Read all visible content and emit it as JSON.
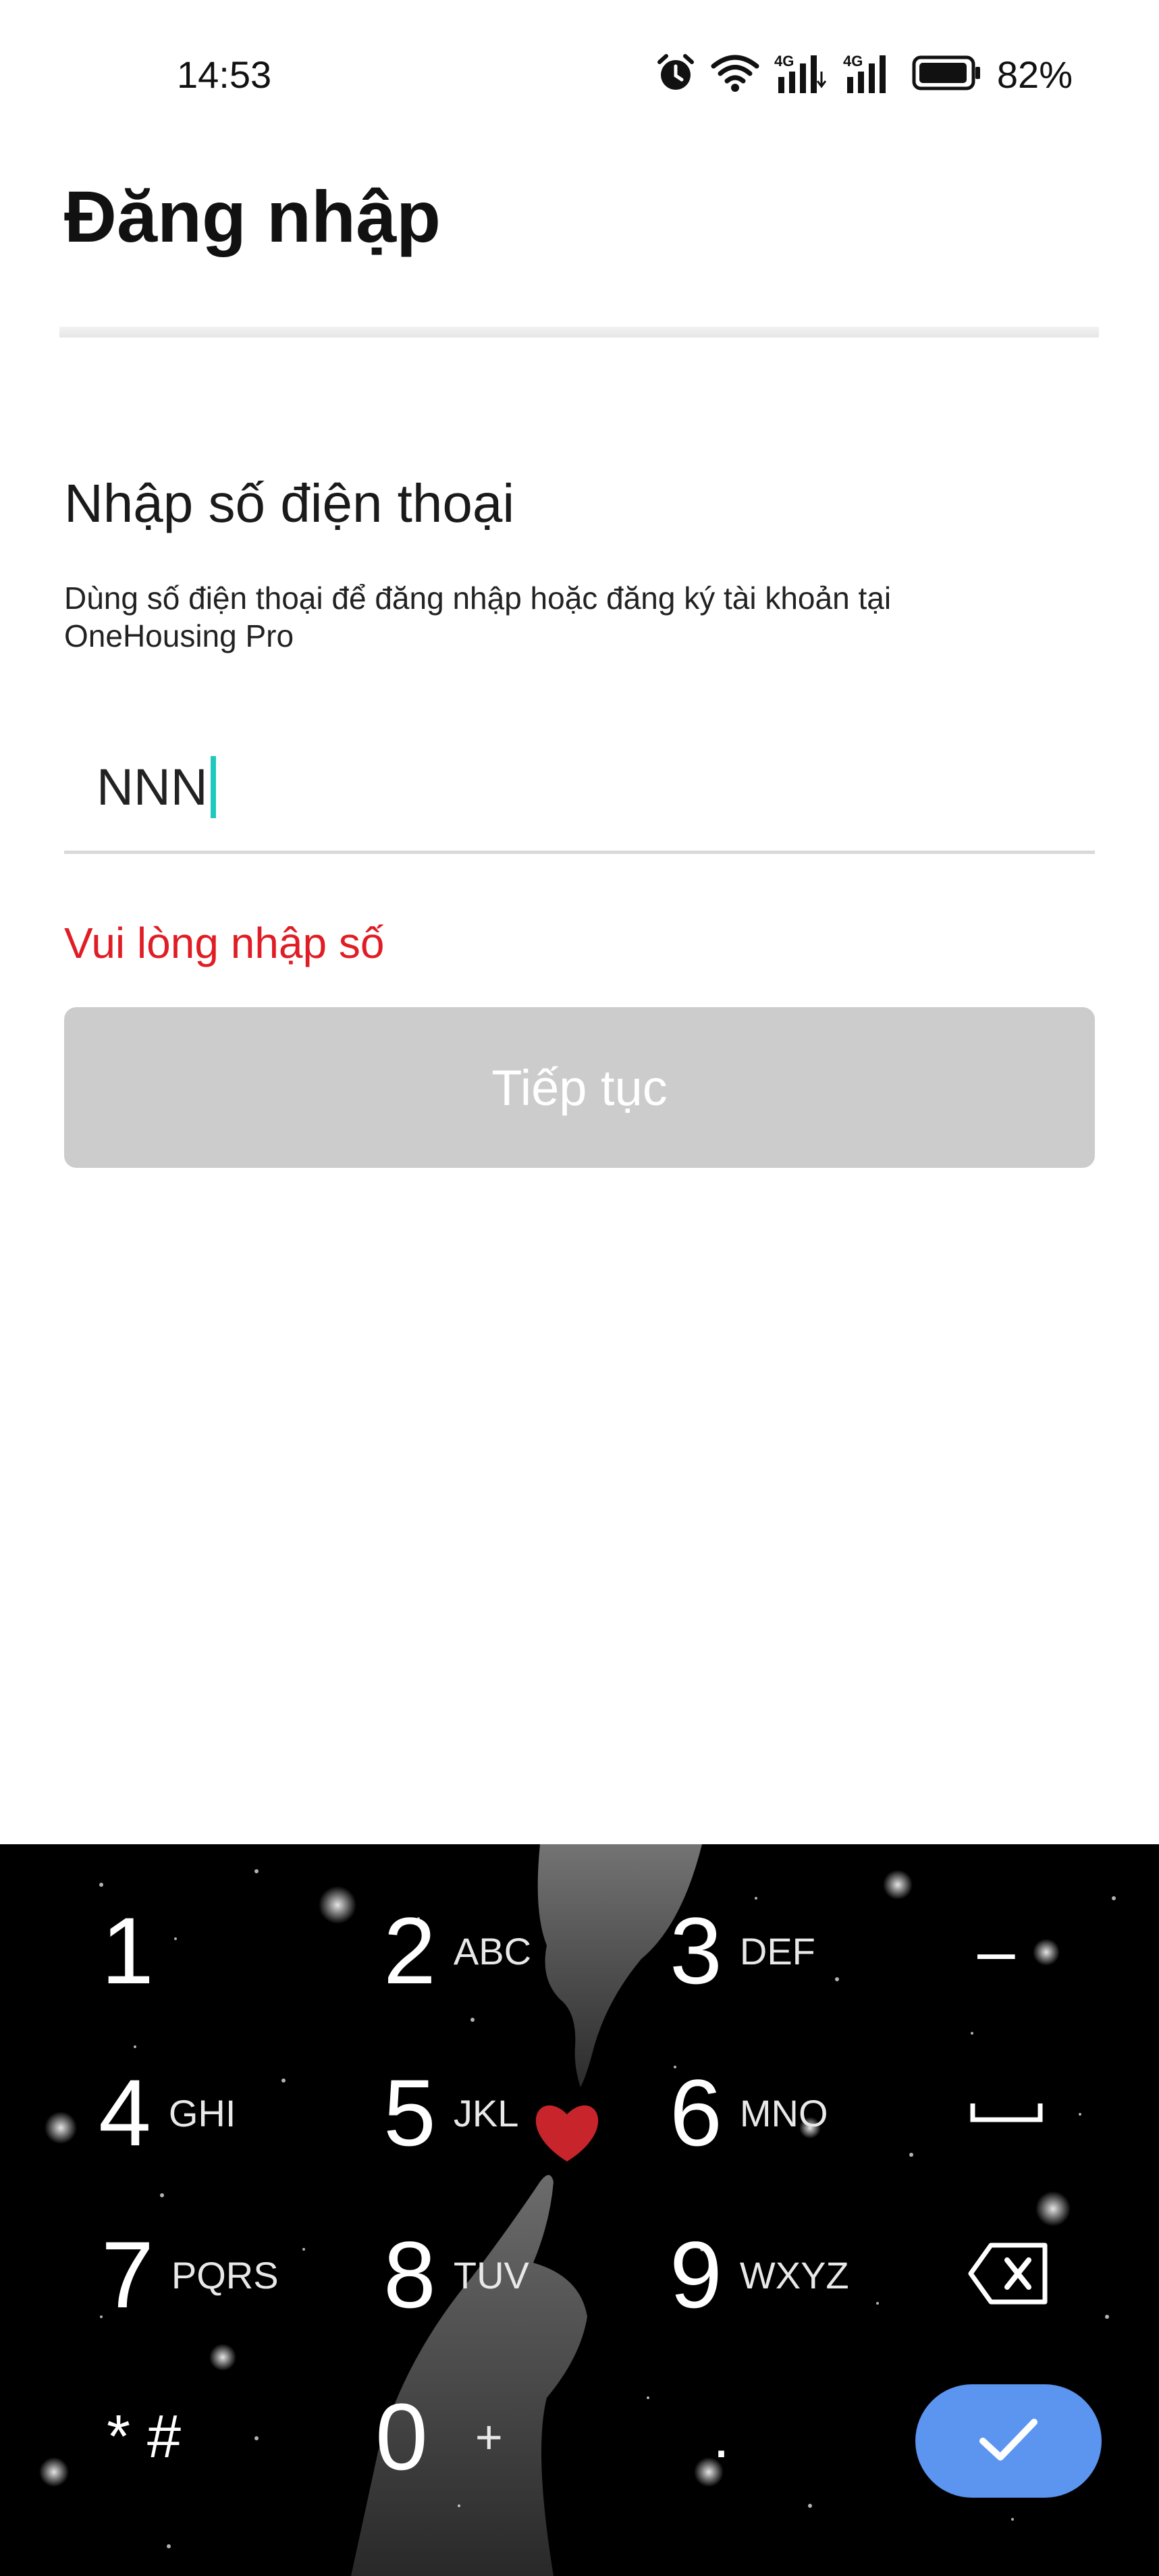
{
  "status_bar": {
    "time": "14:53",
    "battery_percent": "82%",
    "network_1": "4G",
    "network_2": "4G",
    "icons": [
      "alarm-icon",
      "wifi-icon",
      "signal-4g-icon",
      "signal-4g-icon",
      "battery-icon"
    ]
  },
  "header": {
    "title": "Đăng nhập"
  },
  "form": {
    "title": "Nhập số điện thoại",
    "description": "Dùng số điện thoại để đăng nhập hoặc đăng ký tài khoản tại OneHousing Pro",
    "phone_value": "NNN",
    "error": "Vui lòng nhập số",
    "submit_label": "Tiếp tục"
  },
  "keyboard": {
    "keys": [
      {
        "digit": "1",
        "letters": ""
      },
      {
        "digit": "2",
        "letters": "ABC"
      },
      {
        "digit": "3",
        "letters": "DEF"
      },
      {
        "digit": "4",
        "letters": "GHI"
      },
      {
        "digit": "5",
        "letters": "JKL"
      },
      {
        "digit": "6",
        "letters": "MNO"
      },
      {
        "digit": "7",
        "letters": "PQRS"
      },
      {
        "digit": "8",
        "letters": "TUV"
      },
      {
        "digit": "9",
        "letters": "WXYZ"
      },
      {
        "digit": "0",
        "letters": "+"
      }
    ],
    "star_hash": "* #",
    "dash": "–",
    "dot": "."
  },
  "colors": {
    "error": "#e01d24",
    "button_disabled": "#cccccc",
    "caret": "#20c9bd",
    "done_key": "#5b95f0",
    "keyboard_bg": "#000000"
  }
}
